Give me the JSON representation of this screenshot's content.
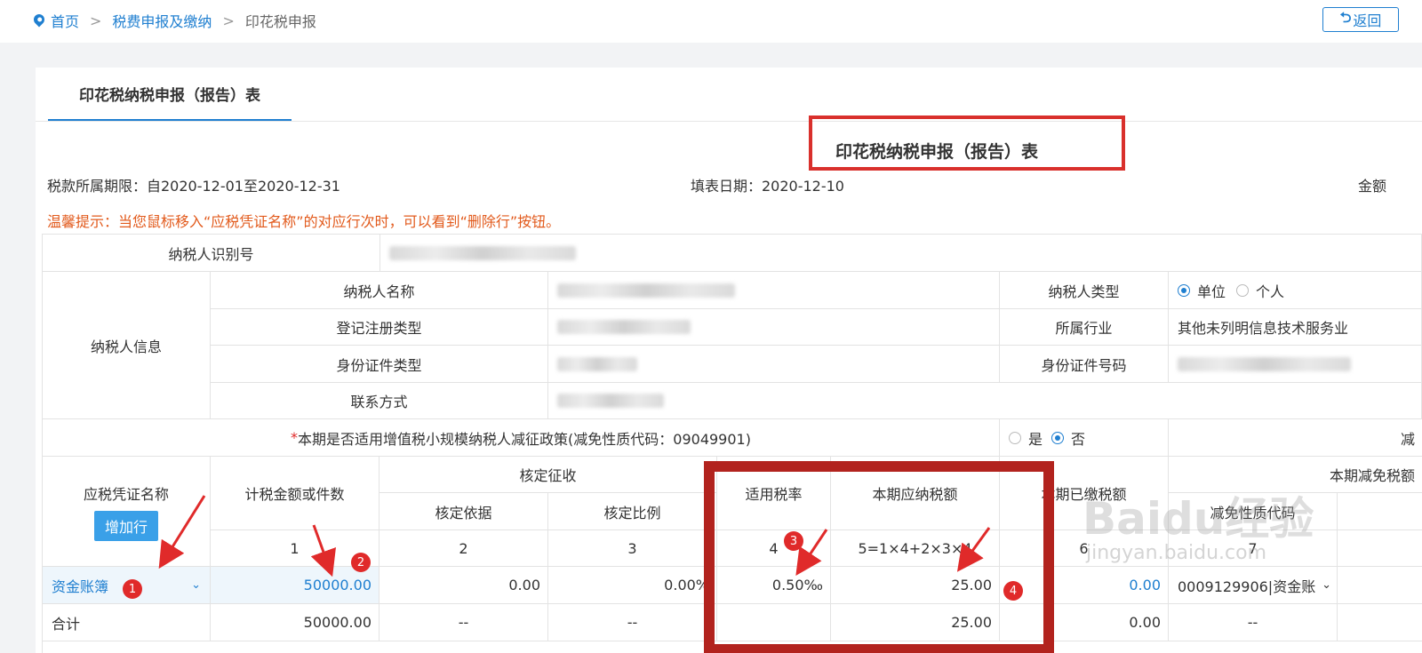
{
  "breadcrumb": {
    "home": "首页",
    "level1": "税费申报及缴纳",
    "current": "印花税申报",
    "separator": ">"
  },
  "back_button": "返回",
  "tab_title": "印花税纳税申报（报告）表",
  "form_title": "印花税纳税申报（报告）表",
  "period": "税款所属期限：自2020-12-01至2020-12-31",
  "fill_date": "填表日期：2020-12-10",
  "amount_label": "金额",
  "tip": "温馨提示：当您鼠标移入“应税凭证名称”的对应行次时，可以看到“删除行”按钮。",
  "taxpayer": {
    "id_label": "纳税人识别号",
    "group_label": "纳税人信息",
    "name_label": "纳税人名称",
    "reg_type_label": "登记注册类型",
    "id_doc_type_label": "身份证件类型",
    "contact_label": "联系方式",
    "type_label": "纳税人类型",
    "type_options": [
      "单位",
      "个人"
    ],
    "type_selected": "单位",
    "industry_label": "所属行业",
    "industry_value": "其他未列明信息技术服务业",
    "id_doc_no_label": "身份证件号码"
  },
  "policy": {
    "label": "本期是否适用增值税小规模纳税人减征政策(减免性质代码：09049901)",
    "asterisk": "*",
    "options": [
      "是",
      "否"
    ],
    "selected": "否",
    "right_label": "减"
  },
  "table": {
    "col_name": "应税凭证名称",
    "add_row": "增加行",
    "col_amount": "计税金额或件数",
    "group_assess": "核定征收",
    "col_basis": "核定依据",
    "col_ratio": "核定比例",
    "col_rate": "适用税率",
    "col_tax": "本期应纳税额",
    "col_paid": "本期已缴税额",
    "group_relief": "本期减免税额",
    "col_relief_code": "减免性质代码",
    "index_row": [
      "1",
      "2",
      "3",
      "4",
      "5=1×4+2×3×4",
      "6",
      "7"
    ],
    "row": {
      "name": "资金账簿",
      "amount": "50000.00",
      "basis": "0.00",
      "ratio": "0.00%",
      "rate": "0.50‰",
      "tax": "25.00",
      "paid": "0.00",
      "relief_code": "0009129906|资金账"
    },
    "total": {
      "label": "合计",
      "amount": "50000.00",
      "basis": "--",
      "ratio": "--",
      "tax": "25.00",
      "paid": "0.00",
      "relief": "--"
    }
  },
  "badges": [
    "1",
    "2",
    "3",
    "4"
  ],
  "watermark": {
    "brand": "Baidu经验",
    "url": "jingyan.baidu.com"
  }
}
